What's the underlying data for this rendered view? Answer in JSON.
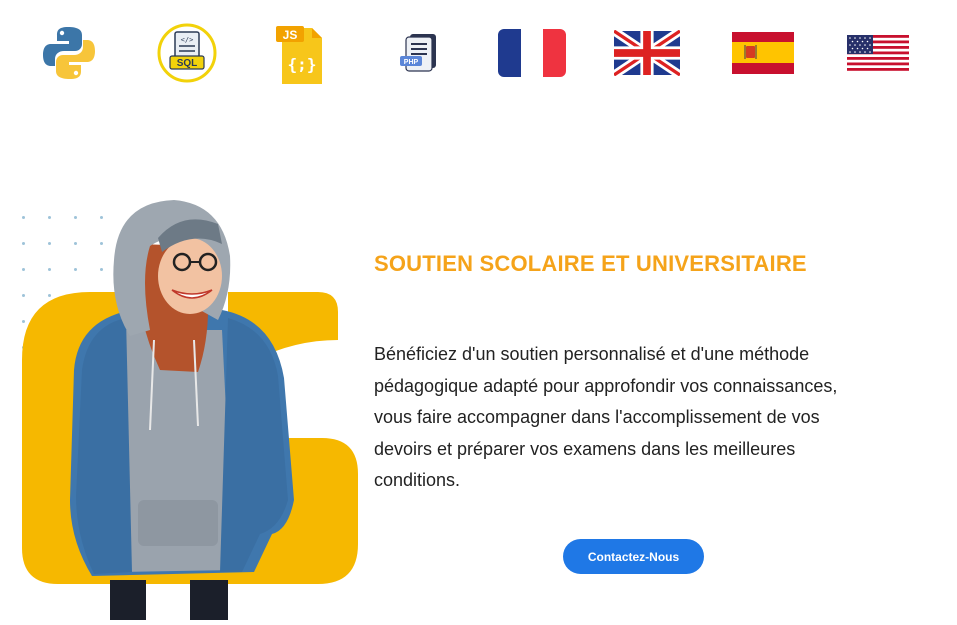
{
  "icons": {
    "python": "python-icon",
    "sql": "sql-icon",
    "js": "javascript-icon",
    "php": "php-icon",
    "fr": "france-flag-icon",
    "uk": "uk-flag-icon",
    "es": "spain-flag-icon",
    "us": "usa-flag-icon"
  },
  "icon_labels": {
    "sql": "SQL",
    "js": "JS",
    "js_braces": "{;}",
    "php": "PHP"
  },
  "colors": {
    "accent_orange": "#f5a31a",
    "button_blue": "#1f78e6",
    "hero_yellow": "#f6b800"
  },
  "hero": {
    "title": "SOUTIEN SCOLAIRE ET UNIVERSITAIRE",
    "description": "Bénéficiez d'un soutien personnalisé et d'une méthode pédagogique adapté pour approfondir vos connaissances, vous faire accompagner dans l'accomplissement de vos devoirs et préparer vos examens dans les meilleures conditions.",
    "cta_label": "Contactez-Nous"
  }
}
